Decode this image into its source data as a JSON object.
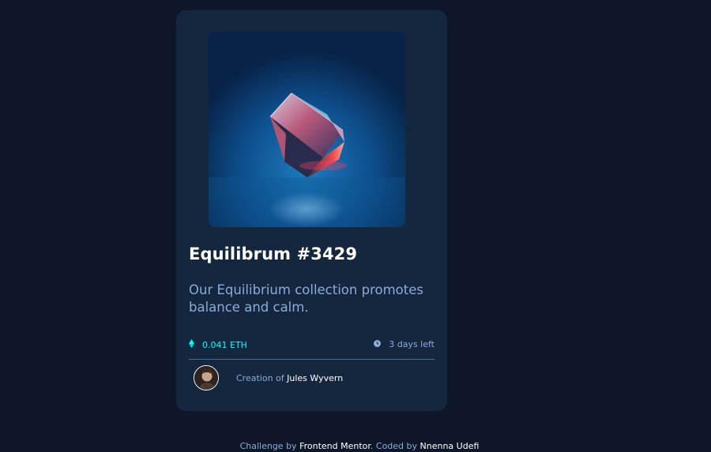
{
  "card": {
    "image_alt": "equilibrium-cube-image",
    "title": "Equilibrum #3429",
    "description": "Our Equilibrium collection promotes balance and calm.",
    "price": "0.041 ETH",
    "time_left": "3 days left",
    "creator_prefix": "Creation of",
    "creator_name": "Jules Wyvern"
  },
  "footer": {
    "challenge_prefix": "Challenge by",
    "challenge_link": "Frontend Mentor",
    "coded_prefix": ". Coded by",
    "coded_link": "Nnenna Udefi"
  },
  "colors": {
    "background": "#0d1729",
    "card": "#15263f",
    "accent": "#00fff8",
    "soft_blue": "#8bacd9",
    "white": "#ffffff"
  },
  "icons": [
    "ethereum-icon",
    "clock-icon"
  ]
}
